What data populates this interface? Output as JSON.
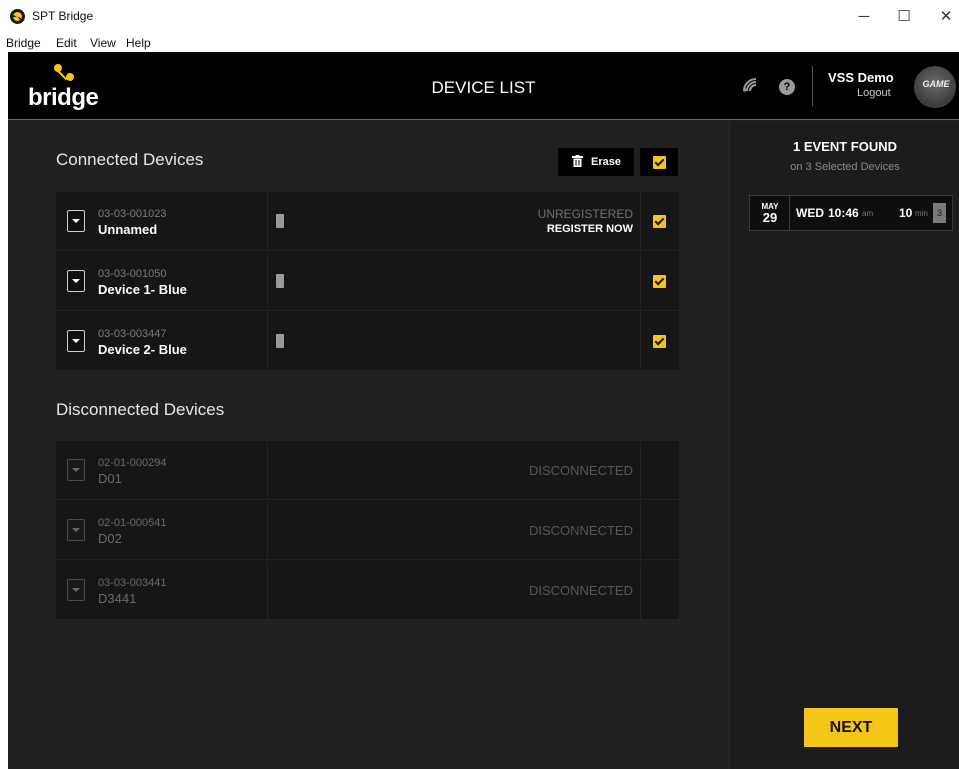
{
  "window": {
    "title": "SPT Bridge",
    "minimize_glyph": "─",
    "maximize_glyph": "☐",
    "close_glyph": "✕"
  },
  "menu": [
    "Bridge",
    "Edit",
    "View",
    "Help"
  ],
  "header": {
    "logo_text": "bridge",
    "page_title": "DEVICE LIST",
    "signal_glyph": "📶",
    "help_glyph": "?",
    "user_name": "VSS Demo",
    "logout_label": "Logout",
    "avatar_text": "GAME"
  },
  "connected": {
    "title": "Connected Devices",
    "erase_label": "Erase",
    "erase_icon": "trash-icon",
    "select_all_checked": true,
    "devices": [
      {
        "id": "03-03-001023",
        "name": "Unnamed",
        "status": "UNREGISTERED",
        "action": "REGISTER NOW",
        "checked": true
      },
      {
        "id": "03-03-001050",
        "name": "Device 1- Blue",
        "status": "",
        "action": "",
        "checked": true
      },
      {
        "id": "03-03-003447",
        "name": "Device 2- Blue",
        "status": "",
        "action": "",
        "checked": true
      }
    ]
  },
  "disconnected": {
    "title": "Disconnected Devices",
    "devices": [
      {
        "id": "02-01-000294",
        "name": "D01",
        "status": "DISCONNECTED"
      },
      {
        "id": "02-01-000541",
        "name": "D02",
        "status": "DISCONNECTED"
      },
      {
        "id": "03-03-003441",
        "name": "D3441",
        "status": "DISCONNECTED"
      }
    ]
  },
  "events": {
    "found_label": "1 EVENT FOUND",
    "sub_label": "on 3 Selected Devices",
    "items": [
      {
        "month": "MAY",
        "day": "29",
        "weekday": "WED",
        "time": "10:46",
        "ampm": "am",
        "duration": "10",
        "duration_unit": "min",
        "device_count": "3"
      }
    ]
  },
  "next_label": "NEXT",
  "colors": {
    "accent": "#f5c518",
    "background": "#212121",
    "header": "#000000",
    "row": "#161616"
  }
}
